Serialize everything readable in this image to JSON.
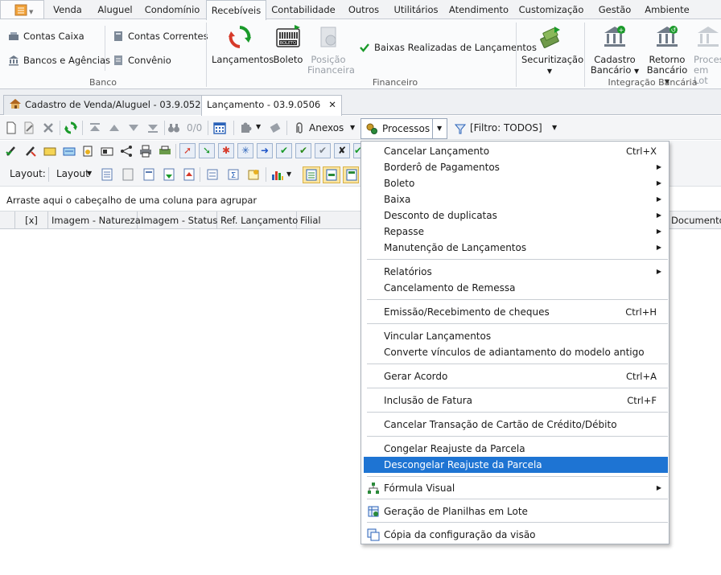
{
  "ribbon_tabs": [
    "Venda",
    "Aluguel",
    "Condomínio",
    "Recebíveis",
    "Contabilidade",
    "Outros",
    "Utilitários",
    "Atendimento",
    "Customização",
    "Gestão",
    "Ambiente"
  ],
  "ribbon": {
    "banco": {
      "contas_caixa": "Contas Caixa",
      "bancos_agencias": "Bancos e Agências",
      "contas_correntes": "Contas Correntes",
      "convenio": "Convênio",
      "group_label": "Banco"
    },
    "financeiro": {
      "lancamentos": "Lançamentos",
      "boleto": "Boleto",
      "posicao_l1": "Posição",
      "posicao_l2": "Financeira",
      "baixas": "Baixas Realizadas de Lançamentos",
      "group_label": "Financeiro"
    },
    "securitizacao": {
      "label": "Securitização"
    },
    "integracao": {
      "cadastro_l1": "Cadastro",
      "cadastro_l2": "Bancário",
      "retorno_l1": "Retorno",
      "retorno_l2": "Bancário",
      "proces_l1": "Proces",
      "proces_l2": "em Lot",
      "group_label": "Integração Bancária"
    }
  },
  "doc_tabs": [
    {
      "label": "Cadastro de Venda/Aluguel - 03.9.0524"
    },
    {
      "label": "Lançamento - 03.9.0506"
    }
  ],
  "toolbar1": {
    "counter": "0/0",
    "anexos": "Anexos",
    "processos": "Processos",
    "filtro": "[Filtro: TODOS]"
  },
  "toolbar3": {
    "layout_label": "Layout:",
    "layout_dropdown": "Layout"
  },
  "group_hint": "Arraste aqui o cabeçalho de uma coluna para agrupar",
  "columns": [
    "[x]",
    "Imagem - Natureza",
    "Imagem - Status",
    "Ref. Lançamento",
    "Filial",
    "Documento"
  ],
  "menu": {
    "items": [
      {
        "label": "Cancelar Lançamento",
        "shortcut": "Ctrl+X"
      },
      {
        "label": "Borderô de Pagamentos",
        "submenu": "▶"
      },
      {
        "label": "Boleto",
        "submenu": "▶"
      },
      {
        "label": "Baixa",
        "submenu": "▶"
      },
      {
        "label": "Desconto de duplicatas",
        "submenu": "▶"
      },
      {
        "label": "Repasse",
        "submenu": "▶"
      },
      {
        "label": "Manutenção de Lançamentos",
        "submenu": "▶"
      },
      {
        "label": "Relatórios",
        "submenu": "▶"
      },
      {
        "label": "Cancelamento de Remessa"
      },
      {
        "label": "Emissão/Recebimento de cheques",
        "shortcut": "Ctrl+H"
      },
      {
        "label": "Vincular Lançamentos"
      },
      {
        "label": "Converte vínculos de adiantamento do modelo antigo"
      },
      {
        "label": "Gerar Acordo",
        "shortcut": "Ctrl+A"
      },
      {
        "label": "Inclusão de Fatura",
        "shortcut": "Ctrl+F"
      },
      {
        "label": "Cancelar Transação de Cartão de Crédito/Débito"
      },
      {
        "label": "Congelar Reajuste da Parcela"
      },
      {
        "label": "Descongelar Reajuste da Parcela"
      },
      {
        "label": "Fórmula Visual",
        "submenu": "▶"
      },
      {
        "label": "Geração de Planilhas em Lote"
      },
      {
        "label": "Cópia da configuração da visão"
      }
    ]
  },
  "colors": {
    "highlight": "#1e74d3",
    "check_green": "#1a9a2a",
    "accent_blue": "#2a62b8"
  }
}
